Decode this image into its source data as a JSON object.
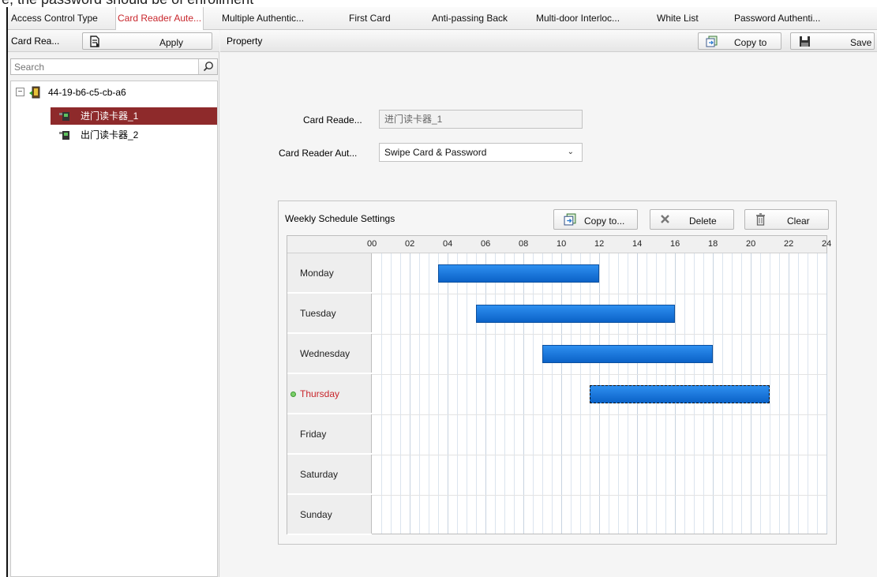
{
  "caption": "e, the password should be of enrollment",
  "tabs": [
    {
      "label": "Access Control Type"
    },
    {
      "label": "Card Reader Aute..."
    },
    {
      "label": "Multiple Authentic..."
    },
    {
      "label": "First Card"
    },
    {
      "label": "Anti-passing Back"
    },
    {
      "label": "Multi-door Interloc..."
    },
    {
      "label": "White List"
    },
    {
      "label": "Password Authenti..."
    }
  ],
  "left": {
    "title": "Card Rea...",
    "apply_label": "Apply",
    "search_placeholder": "Search",
    "tree": {
      "device": "44-19-b6-c5-cb-a6",
      "expander": "−",
      "readers": [
        "进门读卡器_1",
        "出门读卡器_2"
      ]
    }
  },
  "property": {
    "title": "Property",
    "copy_to_label": "Copy to",
    "save_label": "Save",
    "card_reader_label": "Card Reade...",
    "card_reader_value": "进门读卡器_1",
    "auth_label": "Card Reader Aut...",
    "auth_value": "Swipe Card & Password"
  },
  "schedule": {
    "title": "Weekly Schedule Settings",
    "copy_to_label": "Copy to...",
    "delete_label": "Delete",
    "clear_label": "Clear",
    "hours": [
      "00",
      "02",
      "04",
      "06",
      "08",
      "10",
      "12",
      "14",
      "16",
      "18",
      "20",
      "22",
      "24"
    ],
    "days": [
      {
        "name": "Monday",
        "start": 3.5,
        "end": 12
      },
      {
        "name": "Tuesday",
        "start": 5.5,
        "end": 16
      },
      {
        "name": "Wednesday",
        "start": 9,
        "end": 18
      },
      {
        "name": "Thursday",
        "start": 11.5,
        "end": 21,
        "active": true
      },
      {
        "name": "Friday"
      },
      {
        "name": "Saturday"
      },
      {
        "name": "Sunday"
      }
    ]
  },
  "colors": {
    "accent": "#c8262c",
    "selection": "#8e2a2b",
    "bar": "#1578e0"
  }
}
